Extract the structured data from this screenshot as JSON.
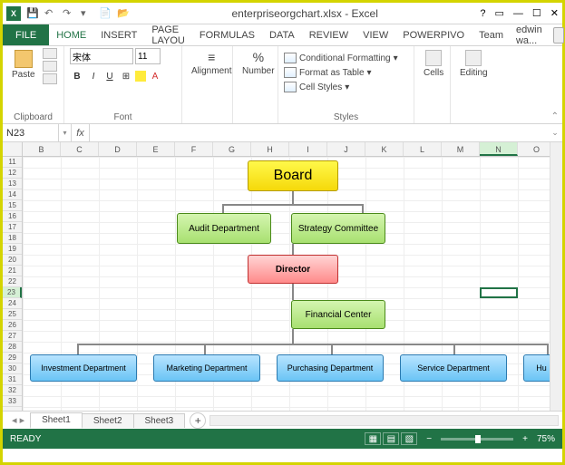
{
  "titlebar": {
    "filename": "enterpriseorgchart.xlsx",
    "app": "Excel",
    "separator": " - "
  },
  "user": {
    "name": "edwin wa..."
  },
  "ribbon_tabs": {
    "file": "FILE",
    "items": [
      "HOME",
      "INSERT",
      "PAGE LAYOU",
      "FORMULAS",
      "DATA",
      "REVIEW",
      "VIEW",
      "POWERPIVO",
      "Team"
    ],
    "active": 0
  },
  "ribbon": {
    "clipboard": {
      "label": "Clipboard",
      "paste": "Paste"
    },
    "font": {
      "label": "Font",
      "family": "宋体",
      "size": "11"
    },
    "alignment": {
      "label": "Alignment",
      "btn": "Alignment"
    },
    "number": {
      "label": "Number",
      "btn": "Number",
      "percent": "%"
    },
    "styles": {
      "label": "Styles",
      "cf": "Conditional Formatting",
      "table": "Format as Table",
      "cell": "Cell Styles"
    },
    "cells": {
      "label": "Cells",
      "btn": "Cells"
    },
    "editing": {
      "label": "Editing",
      "btn": "Editing"
    }
  },
  "namebox": {
    "value": "N23"
  },
  "formula": {
    "fx": "fx",
    "value": ""
  },
  "columns": [
    "B",
    "C",
    "D",
    "E",
    "F",
    "G",
    "H",
    "I",
    "J",
    "K",
    "L",
    "M",
    "N",
    "O"
  ],
  "active_col": "N",
  "rows": [
    11,
    12,
    13,
    14,
    15,
    16,
    17,
    18,
    19,
    20,
    21,
    22,
    23,
    24,
    25,
    26,
    27,
    28,
    29,
    30,
    31,
    32,
    33
  ],
  "active_row": 23,
  "chart_data": {
    "type": "orgchart",
    "nodes": [
      {
        "id": "board",
        "label": "Board",
        "color": "yellow",
        "level": 0
      },
      {
        "id": "audit",
        "label": "Audit Department",
        "color": "green",
        "level": 1,
        "parent": "board"
      },
      {
        "id": "strategy",
        "label": "Strategy Committee",
        "color": "green",
        "level": 1,
        "parent": "board"
      },
      {
        "id": "director",
        "label": "Director",
        "color": "red",
        "level": 2,
        "parent": "board"
      },
      {
        "id": "financial",
        "label": "Financial Center",
        "color": "green",
        "level": 3,
        "parent": "director"
      },
      {
        "id": "investment",
        "label": "Investment Department",
        "color": "blue",
        "level": 4,
        "parent": "director"
      },
      {
        "id": "marketing",
        "label": "Marketing Department",
        "color": "blue",
        "level": 4,
        "parent": "director"
      },
      {
        "id": "purchasing",
        "label": "Purchasing Department",
        "color": "blue",
        "level": 4,
        "parent": "director"
      },
      {
        "id": "service",
        "label": "Service Department",
        "color": "blue",
        "level": 4,
        "parent": "director"
      },
      {
        "id": "hu",
        "label": "Hu",
        "color": "blue",
        "level": 4,
        "parent": "director"
      }
    ]
  },
  "sheets": {
    "items": [
      "Sheet1",
      "Sheet2",
      "Sheet3"
    ],
    "active": 0
  },
  "status": {
    "ready": "READY",
    "zoom": "75%",
    "minus": "−",
    "plus": "+"
  }
}
